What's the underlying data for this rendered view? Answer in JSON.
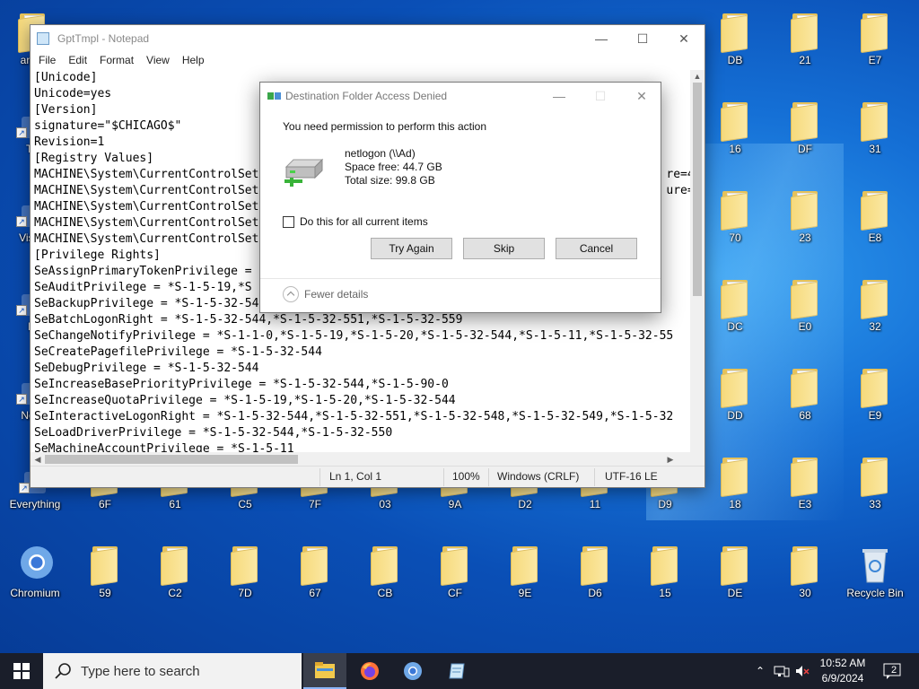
{
  "desktop": {
    "icons": [
      {
        "label": "anon",
        "type": "folder"
      },
      {
        "label": "Th",
        "type": "app"
      },
      {
        "label": "Visua",
        "type": "app"
      },
      {
        "label": "Fi",
        "type": "app"
      },
      {
        "label": "Note",
        "type": "app"
      },
      {
        "label": "Everything",
        "type": "app"
      },
      {
        "label": "Chromium",
        "type": "app"
      },
      {
        "label": "DB",
        "type": "folder"
      },
      {
        "label": "21",
        "type": "folder"
      },
      {
        "label": "E7",
        "type": "folder"
      },
      {
        "label": "16",
        "type": "folder"
      },
      {
        "label": "DF",
        "type": "folder"
      },
      {
        "label": "31",
        "type": "folder"
      },
      {
        "label": "70",
        "type": "folder"
      },
      {
        "label": "23",
        "type": "folder"
      },
      {
        "label": "E8",
        "type": "folder"
      },
      {
        "label": "DC",
        "type": "folder"
      },
      {
        "label": "E0",
        "type": "folder"
      },
      {
        "label": "32",
        "type": "folder"
      },
      {
        "label": "DD",
        "type": "folder"
      },
      {
        "label": "68",
        "type": "folder"
      },
      {
        "label": "E9",
        "type": "folder"
      },
      {
        "label": "6F",
        "type": "folder"
      },
      {
        "label": "61",
        "type": "folder"
      },
      {
        "label": "C5",
        "type": "folder"
      },
      {
        "label": "7F",
        "type": "folder"
      },
      {
        "label": "03",
        "type": "folder"
      },
      {
        "label": "9A",
        "type": "folder"
      },
      {
        "label": "D2",
        "type": "folder"
      },
      {
        "label": "11",
        "type": "folder"
      },
      {
        "label": "D9",
        "type": "folder"
      },
      {
        "label": "18",
        "type": "folder"
      },
      {
        "label": "E3",
        "type": "folder"
      },
      {
        "label": "33",
        "type": "folder"
      },
      {
        "label": "59",
        "type": "folder"
      },
      {
        "label": "C2",
        "type": "folder"
      },
      {
        "label": "7D",
        "type": "folder"
      },
      {
        "label": "67",
        "type": "folder"
      },
      {
        "label": "CB",
        "type": "folder"
      },
      {
        "label": "CF",
        "type": "folder"
      },
      {
        "label": "9E",
        "type": "folder"
      },
      {
        "label": "D6",
        "type": "folder"
      },
      {
        "label": "15",
        "type": "folder"
      },
      {
        "label": "DE",
        "type": "folder"
      },
      {
        "label": "30",
        "type": "folder"
      },
      {
        "label": "Recycle Bin",
        "type": "recycle-bin"
      }
    ]
  },
  "notepad": {
    "title": "GptTmpl - Notepad",
    "menu": [
      "File",
      "Edit",
      "Format",
      "View",
      "Help"
    ],
    "lines": [
      "[Unicode]",
      "Unicode=yes",
      "[Version]",
      "signature=\"$CHICAGO$\"",
      "Revision=1",
      "[Registry Values]",
      "MACHINE\\System\\CurrentControlSet                                                          re=4",
      "MACHINE\\System\\CurrentControlSet                                                          ure=",
      "MACHINE\\System\\CurrentControlSet",
      "MACHINE\\System\\CurrentControlSet",
      "MACHINE\\System\\CurrentControlSet",
      "[Privilege Rights]",
      "SeAssignPrimaryTokenPrivilege =",
      "SeAuditPrivilege = *S-1-5-19,*S",
      "SeBackupPrivilege = *S-1-5-32-54",
      "SeBatchLogonRight = *S-1-5-32-544,*S-1-5-32-551,*S-1-5-32-559",
      "SeChangeNotifyPrivilege = *S-1-1-0,*S-1-5-19,*S-1-5-20,*S-1-5-32-544,*S-1-5-11,*S-1-5-32-55",
      "SeCreatePagefilePrivilege = *S-1-5-32-544",
      "SeDebugPrivilege = *S-1-5-32-544",
      "SeIncreaseBasePriorityPrivilege = *S-1-5-32-544,*S-1-5-90-0",
      "SeIncreaseQuotaPrivilege = *S-1-5-19,*S-1-5-20,*S-1-5-32-544",
      "SeInteractiveLogonRight = *S-1-5-32-544,*S-1-5-32-551,*S-1-5-32-548,*S-1-5-32-549,*S-1-5-32",
      "SeLoadDriverPrivilege = *S-1-5-32-544,*S-1-5-32-550",
      "SeMachineAccountPrivilege = *S-1-5-11"
    ],
    "status": {
      "position": "Ln 1, Col 1",
      "zoom": "100%",
      "line_endings": "Windows (CRLF)",
      "encoding": "UTF-16 LE"
    }
  },
  "dialog": {
    "title": "Destination Folder Access Denied",
    "message": "You need permission to perform this action",
    "drive_name": "netlogon (\\\\Ad)",
    "space_free": "Space free: 44.7 GB",
    "total_size": "Total size: 99.8 GB",
    "checkbox_label": "Do this for all current items",
    "checkbox_checked": false,
    "buttons": {
      "try_again": "Try Again",
      "skip": "Skip",
      "cancel": "Cancel"
    },
    "fewer_details": "Fewer details"
  },
  "taskbar": {
    "search_placeholder": "Type here to search",
    "apps": [
      "file-explorer",
      "firefox",
      "chromium",
      "notepad-like"
    ],
    "clock_time": "10:52 AM",
    "clock_date": "6/9/2024",
    "notification_count": "2"
  },
  "colors": {
    "taskbar": "#1a1e2a",
    "desktop_blue": "#1570d6",
    "button_face": "#e1e1e1"
  }
}
